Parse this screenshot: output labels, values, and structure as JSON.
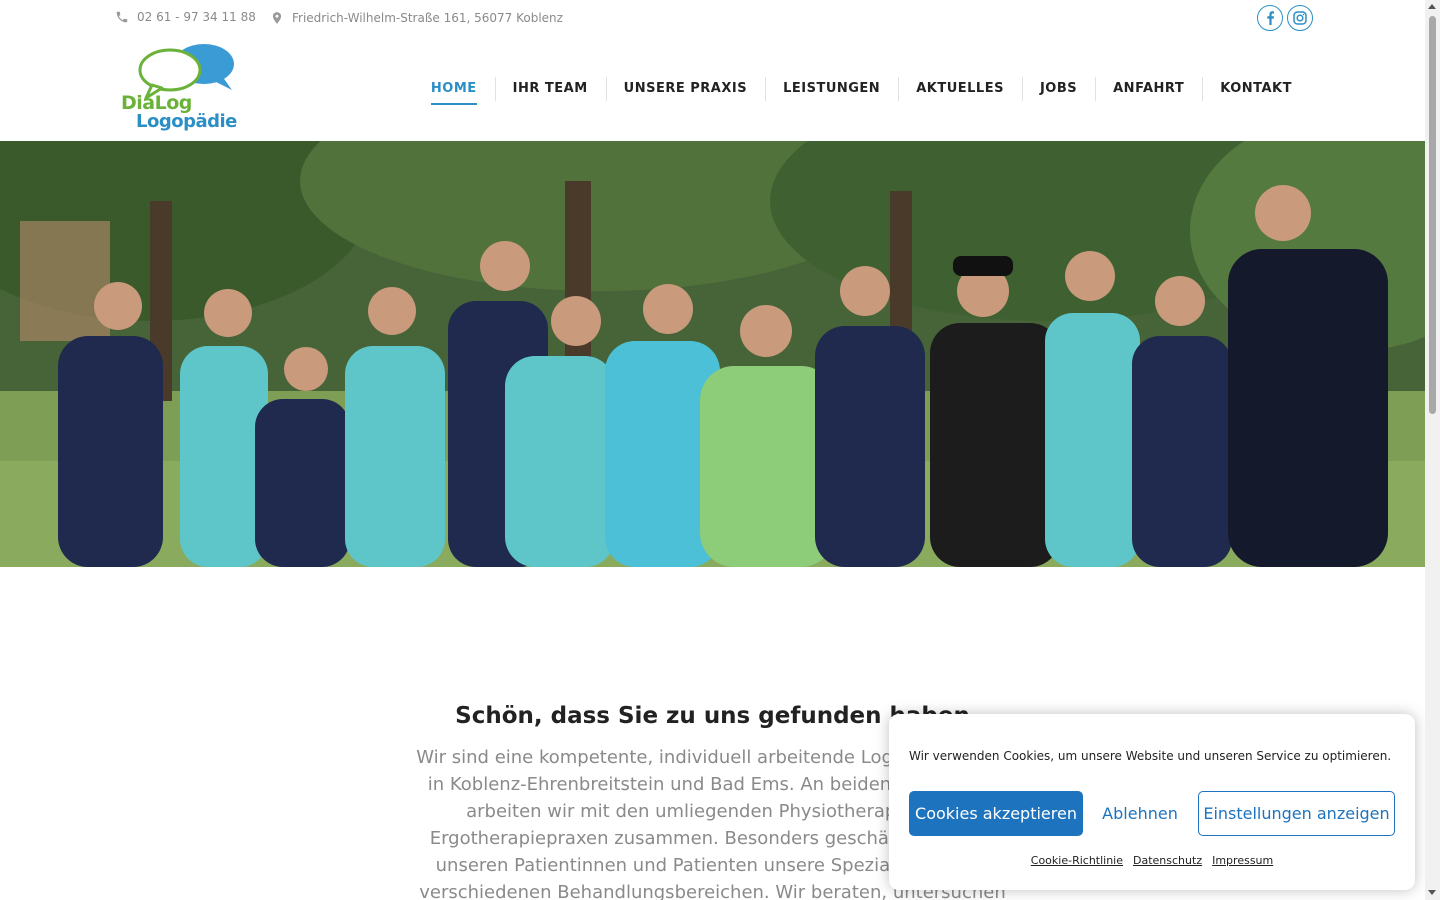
{
  "topbar": {
    "phone": "02 61 - 97 34 11 88",
    "address": "Friedrich-Wilhelm-Straße 161, 56077 Koblenz",
    "social": [
      "facebook-icon",
      "instagram-icon"
    ]
  },
  "logo": {
    "line1": "DiaLog",
    "line2": "Logopädie"
  },
  "nav": {
    "items": [
      {
        "label": "HOME"
      },
      {
        "label": "IHR TEAM"
      },
      {
        "label": "UNSERE PRAXIS"
      },
      {
        "label": "LEISTUNGEN"
      },
      {
        "label": "AKTUELLES"
      },
      {
        "label": "JOBS"
      },
      {
        "label": "ANFAHRT"
      },
      {
        "label": "KONTAKT"
      }
    ],
    "active": "HOME"
  },
  "content": {
    "title": "Schön, dass Sie zu uns gefunden haben",
    "text": "Wir sind eine kompetente, individuell arbeitende Logopädiepraxis in Koblenz-Ehrenbreitstein und Bad Ems. An beiden Standorten arbeiten wir mit den umliegenden Physiotherapie- und Ergotherapiepraxen zusammen. Besonders geschätzt wird von unseren Patientinnen und Patienten unsere Spezialisierung in verschiedenen Behandlungsbereichen. Wir beraten, untersuchen und"
  },
  "cookie": {
    "message": "Wir verwenden Cookies, um unsere Website und unseren Service zu optimieren.",
    "accept": "Cookies akzeptieren",
    "deny": "Ablehnen",
    "settings": "Einstellungen anzeigen",
    "links": [
      "Cookie-Richtlinie",
      "Datenschutz",
      "Impressum"
    ]
  },
  "colors": {
    "brand_blue": "#2b8fc6",
    "brand_green": "#6bb23a",
    "button_blue": "#1e73be"
  }
}
